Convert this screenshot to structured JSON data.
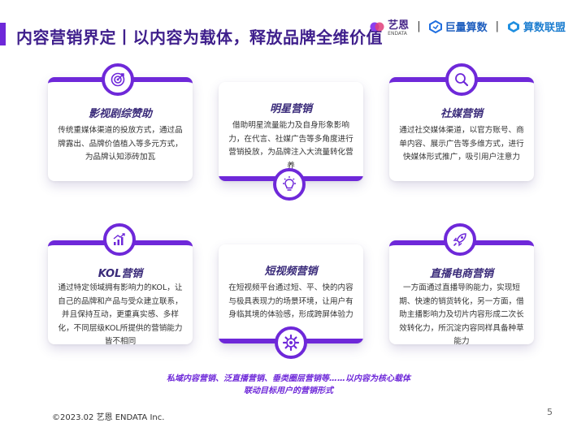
{
  "header": {
    "title": "内容营销界定丨以内容为载体，释放品牌全维价值",
    "logos": [
      {
        "name": "艺恩",
        "sub": "ENDATA"
      },
      {
        "name": "巨量算数"
      },
      {
        "name": "算数联盟"
      }
    ],
    "separator": "|"
  },
  "cards": [
    {
      "title": "影视剧综赞助",
      "body": "传统重媒体渠道的投放方式，通过品牌露出、品牌价值植入等多元方式，为品牌认知添砖加瓦",
      "icon": "target-icon"
    },
    {
      "title": "明星营销",
      "body": "借助明星流量能力及自身形象影响力，在代言、社媒广告等多角度进行营销投放，为品牌注入大流量转化营养",
      "icon": "lightbulb-icon"
    },
    {
      "title": "社媒营销",
      "body": "通过社交媒体渠道，以官方账号、商单内容、展示广告等多维方式，进行快媒体形式推广，吸引用户注意力",
      "icon": "search-icon"
    },
    {
      "title": "KOL营销",
      "body": "通过特定领域拥有影响力的KOL，让自己的品牌和产品与受众建立联系，并且保持互动，更重真实感、多样化，不同层级KOL所提供的营销能力皆不相同",
      "icon": "growth-chart-icon"
    },
    {
      "title": "短视频营销",
      "body": "在短视频平台通过短、平、快的内容与极具表现力的场景环境，让用户有身临其境的体验感，形成跨屏体验力",
      "icon": "gear-icon"
    },
    {
      "title": "直播电商营销",
      "body": "一方面通过直播导购能力，实现短期、快速的销货转化，另一方面，借助主播影响力及切片内容形成二次长效转化力，所沉淀内容同样具备种草能力",
      "icon": "rocket-icon"
    }
  ],
  "footer_note": {
    "line1": "私域内容营销、泛直播营销、垂类圈层营销等……以内容为核心载体",
    "line2": "联动目标用户的营销形式"
  },
  "copyright": "©2023.02 艺恩 ENDATA Inc.",
  "page_number": "5",
  "colors": {
    "accent": "#6e28d9",
    "title": "#3f1f8c",
    "card_title": "#3a2b7a"
  }
}
